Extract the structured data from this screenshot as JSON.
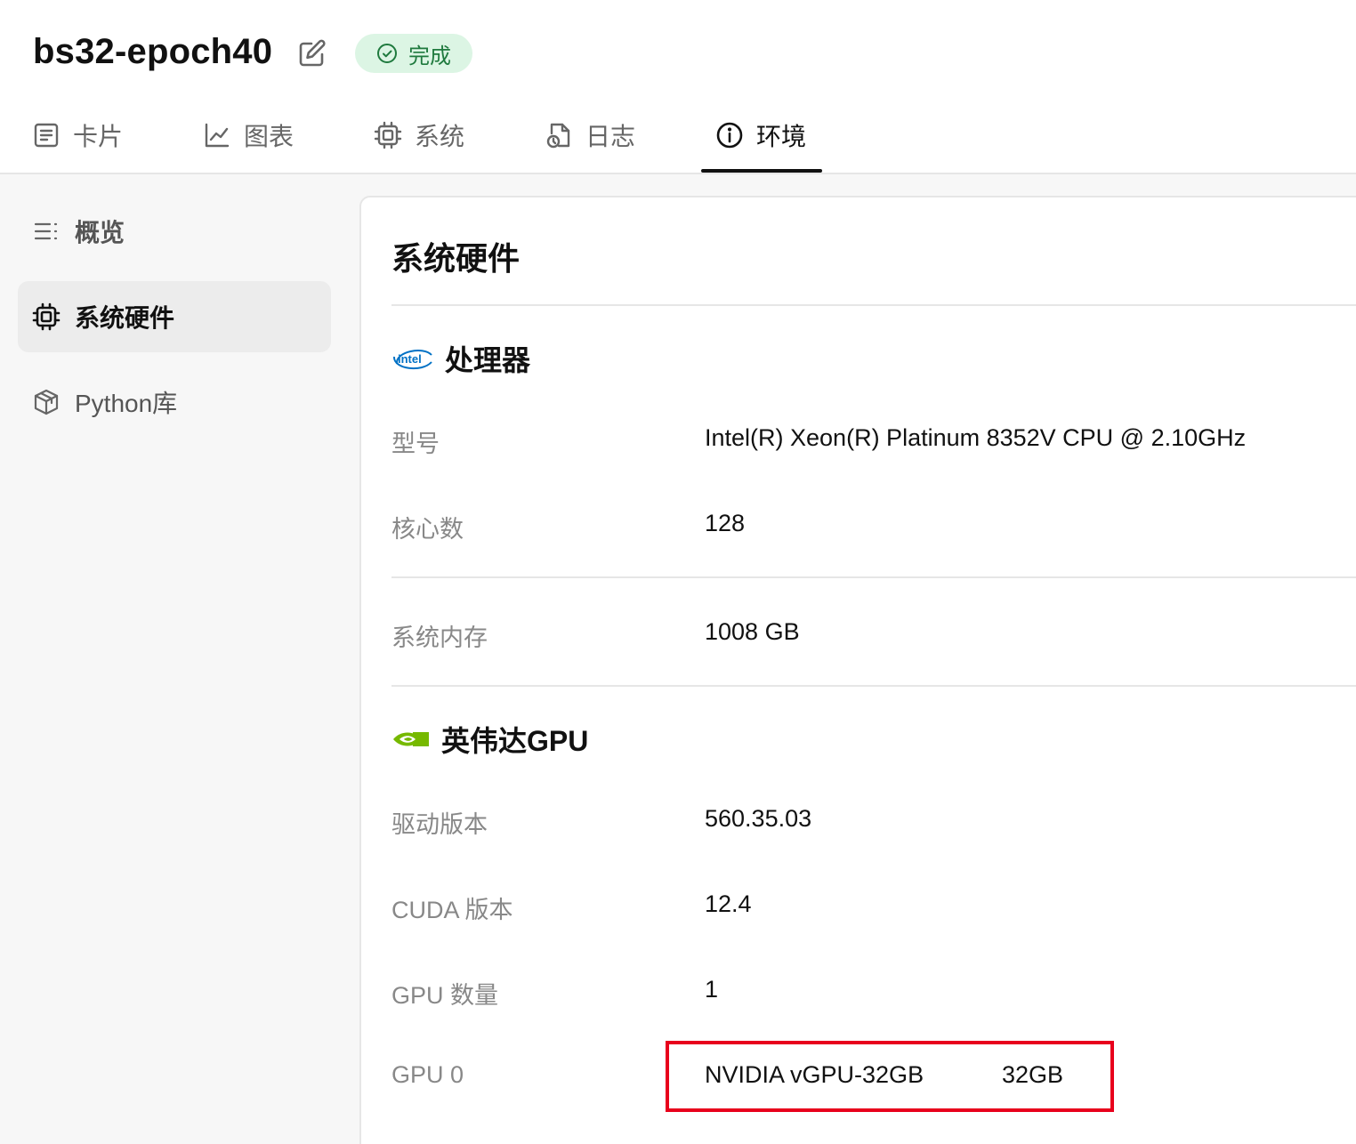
{
  "header": {
    "title": "bs32-epoch40",
    "status": "完成",
    "tabs": [
      {
        "label": "卡片",
        "icon": "card-icon"
      },
      {
        "label": "图表",
        "icon": "chart-icon"
      },
      {
        "label": "系统",
        "icon": "chip-icon"
      },
      {
        "label": "日志",
        "icon": "log-file-icon"
      },
      {
        "label": "环境",
        "icon": "info-icon"
      }
    ],
    "active_tab": "环境"
  },
  "sidebar": {
    "items": [
      {
        "label": "概览",
        "icon": "list-icon"
      },
      {
        "label": "系统硬件",
        "icon": "chip-icon"
      },
      {
        "label": "Python库",
        "icon": "package-icon"
      }
    ],
    "active_item": "系统硬件"
  },
  "panel": {
    "title": "系统硬件",
    "cpu": {
      "heading": "处理器",
      "logo_text": "intel",
      "rows": [
        {
          "label": "型号",
          "value": "Intel(R) Xeon(R) Platinum 8352V CPU @ 2.10GHz"
        },
        {
          "label": "核心数",
          "value": "128"
        }
      ]
    },
    "memory": {
      "label": "系统内存",
      "value": "1008 GB"
    },
    "gpu": {
      "heading": "英伟达GPU",
      "rows": [
        {
          "label": "驱动版本",
          "value": "560.35.03"
        },
        {
          "label": "CUDA 版本",
          "value": "12.4"
        },
        {
          "label": "GPU 数量",
          "value": "1"
        }
      ],
      "gpu0": {
        "label": "GPU 0",
        "name": "NVIDIA vGPU-32GB",
        "memory": "32GB"
      }
    }
  },
  "colors": {
    "status_bg": "#dcf5e4",
    "status_text": "#1f7a3e",
    "highlight": "#e8001c",
    "intel_blue": "#0071c5",
    "nvidia_green": "#76b900"
  }
}
